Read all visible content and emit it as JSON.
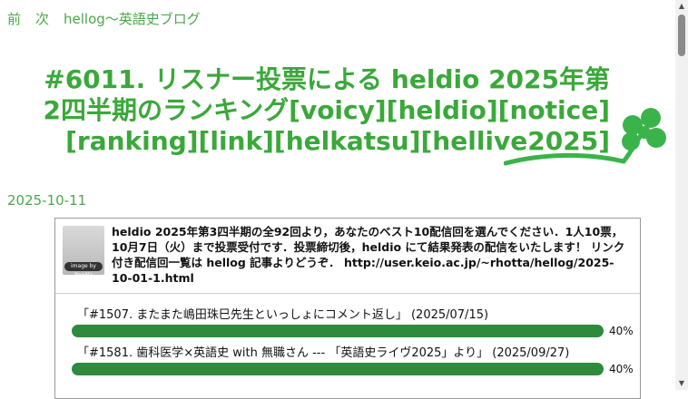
{
  "nav": {
    "prev": "前",
    "next": "次",
    "site": "hellog〜英語史ブログ"
  },
  "post": {
    "title_line1": "#6011. リスナー投票による heldio 2025年第",
    "title_line2": "2四半期のランキング[voicy][heldio][notice]",
    "title_line3": "[ranking][link][helkatsu][hellive2025]",
    "date": "2025-10-11"
  },
  "poll": {
    "thumb_badge": "image by Poodle",
    "description": "heldio 2025年第3四半期の全92回より，あなたのベスト10配信回を選んでください．1人10票，10月7日（火）まで投票受付です．投票締切後，heldio にて結果発表の配信をいたします！ リンク付き配信回一覧は hellog 記事よりどうぞ． http://user.keio.ac.jp/~rhotta/hellog/2025-10-01-1.html",
    "options": [
      {
        "label": "「#1507. またまた嶋田珠巳先生といっしょにコメント返し」 (2025/07/15)",
        "percent": "40%",
        "fill": 1.0
      },
      {
        "label": "「#1581. 歯科医学×英語史 with 無職さん --- 「英語史ライヴ2025」より」 (2025/09/27)",
        "percent": "40%",
        "fill": 1.0
      }
    ]
  },
  "colors": {
    "title": "#3aa83a",
    "bar": "#2e8b3e",
    "clover": "#3ab34a"
  },
  "icons": {
    "clover": "clover-icon",
    "scroll_up": "arrow-up-icon",
    "scroll_down": "arrow-down-icon"
  }
}
